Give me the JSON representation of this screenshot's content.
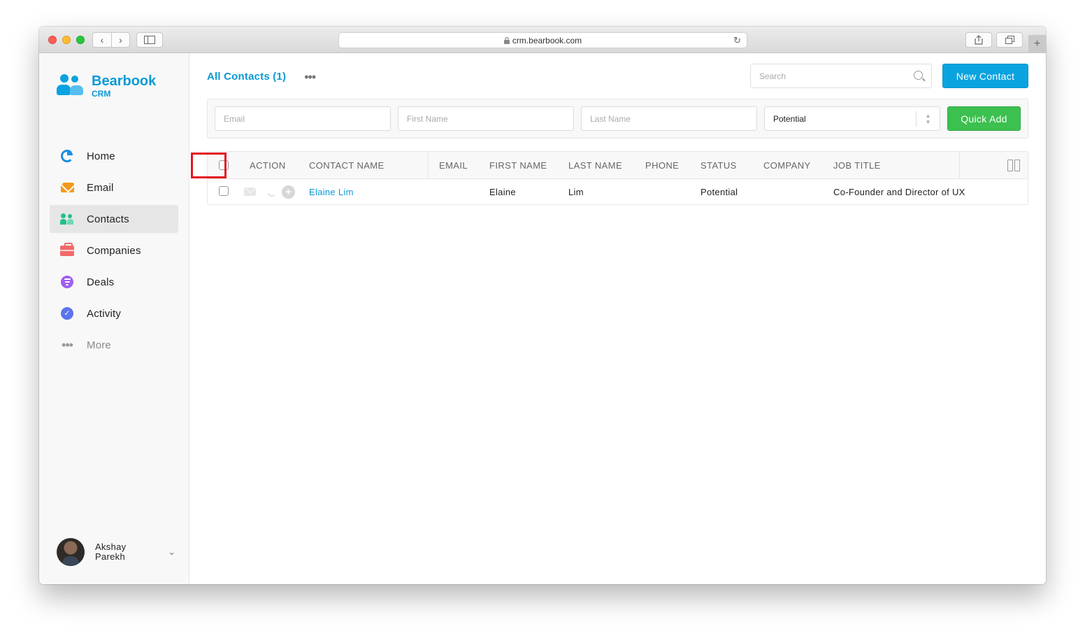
{
  "browser": {
    "url": "crm.bearbook.com",
    "lock_icon": "lock-icon",
    "plus_tab": "+"
  },
  "app": {
    "brand": "Bearbook",
    "brand_sub": "CRM",
    "accent_color": "#0aa3e0",
    "success_color": "#3cc04f"
  },
  "sidebar": {
    "items": [
      {
        "label": "Home",
        "icon": "pie-chart-icon"
      },
      {
        "label": "Email",
        "icon": "mail-icon"
      },
      {
        "label": "Contacts",
        "icon": "people-icon",
        "active": true
      },
      {
        "label": "Companies",
        "icon": "briefcase-icon"
      },
      {
        "label": "Deals",
        "icon": "filter-icon"
      },
      {
        "label": "Activity",
        "icon": "check-circle-icon"
      },
      {
        "label": "More",
        "icon": "more-dots-icon"
      }
    ],
    "user": {
      "first": "Akshay",
      "last": "Parekh"
    }
  },
  "main": {
    "view_title": "All Contacts (1)",
    "search_placeholder": "Search",
    "new_button": "New Contact",
    "quick_add": {
      "email_placeholder": "Email",
      "first_name_placeholder": "First Name",
      "last_name_placeholder": "Last Name",
      "status_value": "Potential",
      "button": "Quick Add"
    },
    "table": {
      "columns": [
        "ACTION",
        "CONTACT NAME",
        "EMAIL",
        "FIRST NAME",
        "LAST NAME",
        "PHONE",
        "STATUS",
        "COMPANY",
        "JOB TITLE"
      ],
      "rows": [
        {
          "contact_name": "Elaine Lim",
          "email": "",
          "first_name": "Elaine",
          "last_name": "Lim",
          "phone": "",
          "status": "Potential",
          "company": "",
          "job_title": "Co-Founder and Director of UX"
        }
      ]
    }
  }
}
